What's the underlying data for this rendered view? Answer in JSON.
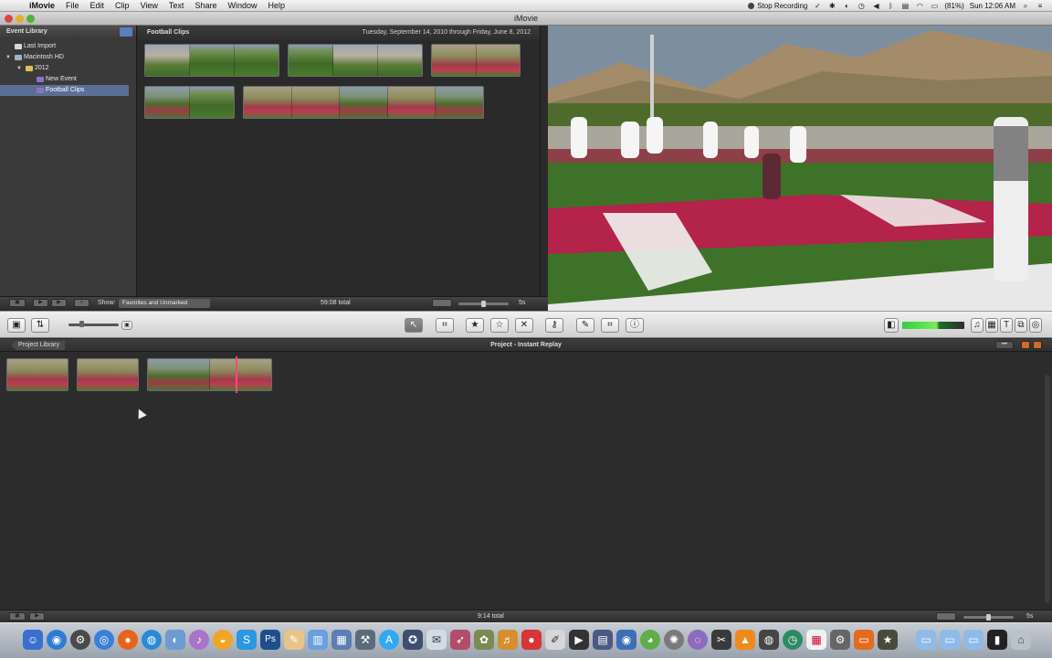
{
  "menu_bar": {
    "apple": "",
    "items": [
      "iMovie",
      "File",
      "Edit",
      "Clip",
      "View",
      "Text",
      "Share",
      "Window",
      "Help"
    ],
    "status": {
      "stop_recording": "Stop Recording",
      "battery": "(81%)",
      "clock": "Sun 12:06 AM"
    }
  },
  "window": {
    "title": "iMovie"
  },
  "event_library": {
    "header": "Event Library",
    "items": [
      {
        "label": "Last Import"
      },
      {
        "label": "Macintosh HD"
      },
      {
        "label": "2012"
      },
      {
        "label": "New Event"
      },
      {
        "label": "Football Clips",
        "selected": true
      }
    ]
  },
  "event_browser": {
    "event_name": "Football Clips",
    "date_range": "Tuesday, September 14, 2010 through Friday, June 8, 2012",
    "toolbar": {
      "show_label": "Show:",
      "show_value": "Favorites and Unmarked",
      "total": "59:08 total",
      "zoom_label": "5s"
    }
  },
  "main_toolbar": {
    "tools": [
      "pointer",
      "select-clip",
      "mark-favorite",
      "unmark",
      "reject",
      "keyword",
      "dropper",
      "crop",
      "inspector"
    ],
    "right_tools": [
      "music",
      "photo",
      "title",
      "transition",
      "map"
    ]
  },
  "project": {
    "back_label": "Project Library",
    "title": "Project - Instant Replay",
    "total": "9:14 total",
    "zoom_label": "5s"
  },
  "dock": {
    "icon_colors": [
      "#3a6fd1",
      "#2e7bd6",
      "#4a4a4a",
      "#3a80d6",
      "#e5641b",
      "#2a8ad8",
      "#6c9bd2",
      "#a874c9",
      "#f0a623",
      "#2a97e0",
      "#31a8f1"
    ]
  }
}
